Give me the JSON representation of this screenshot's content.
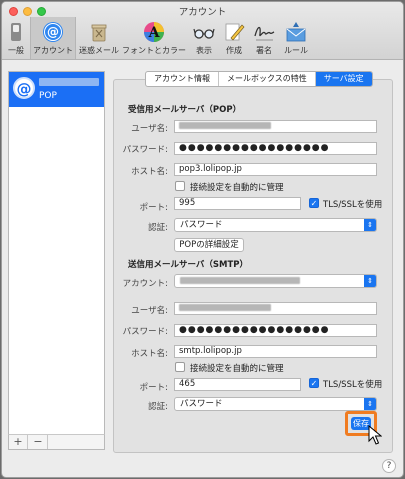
{
  "window": {
    "title": "アカウント"
  },
  "toolbar": {
    "items": [
      {
        "label": "一般",
        "icon": "general-switch-icon"
      },
      {
        "label": "アカウント",
        "icon": "at-sign-icon"
      },
      {
        "label": "迷惑メール",
        "icon": "junk-trash-icon"
      },
      {
        "label": "フォントとカラー",
        "icon": "fonts-colors-icon"
      },
      {
        "label": "表示",
        "icon": "glasses-icon"
      },
      {
        "label": "作成",
        "icon": "pencil-icon"
      },
      {
        "label": "署名",
        "icon": "signature-icon"
      },
      {
        "label": "ルール",
        "icon": "rules-envelope-icon"
      }
    ],
    "active": "アカウント"
  },
  "sidebar": {
    "account": {
      "type": "POP"
    },
    "add_label": "+",
    "remove_label": "−"
  },
  "tabs": {
    "items": [
      "アカウント情報",
      "メールボックスの特性",
      "サーバ設定"
    ],
    "selected": "サーバ設定"
  },
  "pop": {
    "heading": "受信用メールサーバ（POP）",
    "username_label": "ユーザ名:",
    "password_label": "パスワード:",
    "password_value": "●●●●●●●●●●●●●●●●●",
    "host_label": "ホスト名:",
    "host_value": "pop3.lolipop.jp",
    "auto_manage_label": "接続設定を自動的に管理",
    "port_label": "ポート:",
    "port_value": "995",
    "tls_label": "TLS/SSLを使用",
    "auth_label": "認証:",
    "auth_value": "パスワード",
    "advanced_button": "POPの詳細設定"
  },
  "smtp": {
    "heading": "送信用メールサーバ（SMTP）",
    "account_label": "アカウント:",
    "username_label": "ユーザ名:",
    "password_label": "パスワード:",
    "password_value": "●●●●●●●●●●●●●●●●●",
    "host_label": "ホスト名:",
    "host_value": "smtp.lolipop.jp",
    "auto_manage_label": "接続設定を自動的に管理",
    "port_label": "ポート:",
    "port_value": "465",
    "tls_label": "TLS/SSLを使用",
    "auth_label": "認証:",
    "auth_value": "パスワード"
  },
  "footer": {
    "save_label": "保存",
    "help_label": "?"
  },
  "colors": {
    "accent": "#1a75f0",
    "highlight": "#f07c21"
  }
}
